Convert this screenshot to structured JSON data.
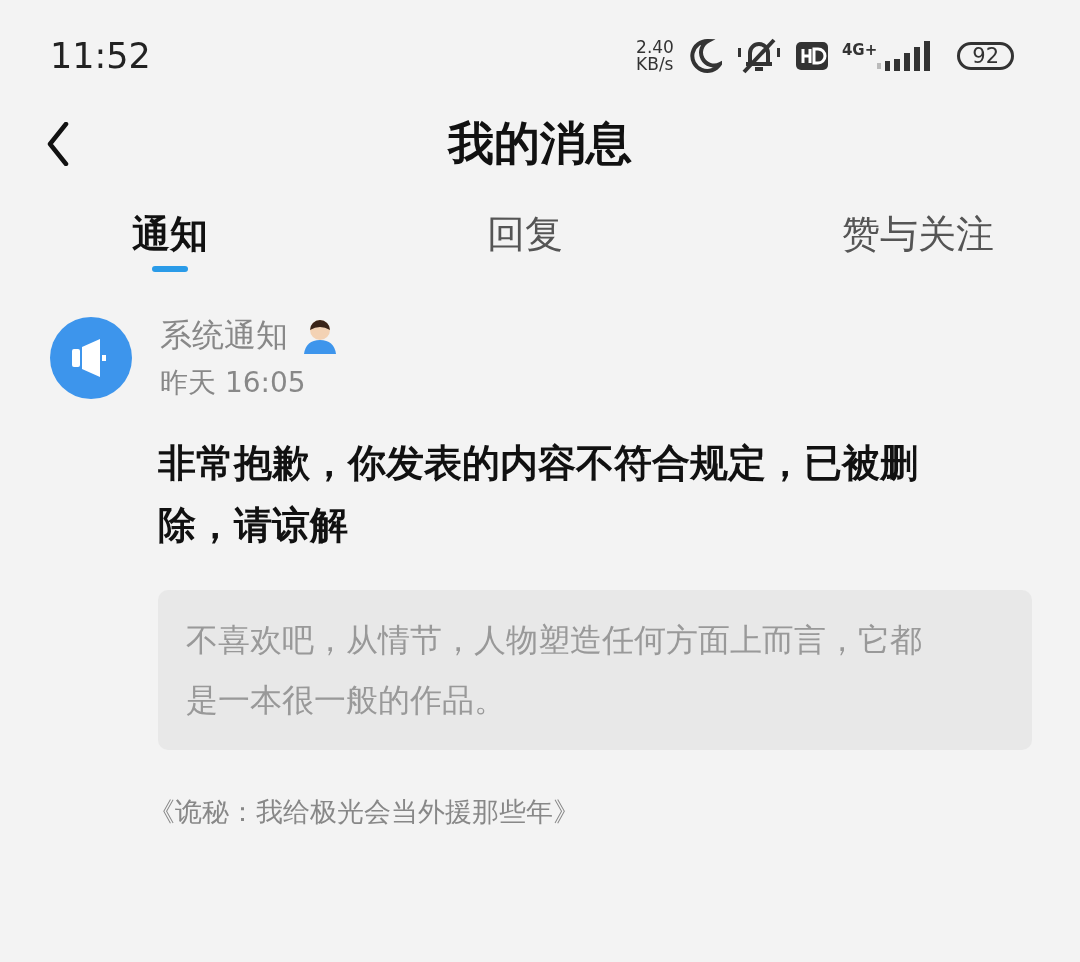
{
  "status_bar": {
    "time": "11:52",
    "speed_value": "2.40",
    "speed_unit": "KB/s",
    "network": "4G+",
    "battery": "92"
  },
  "header": {
    "title": "我的消息"
  },
  "tabs": [
    {
      "label": "通知",
      "selected": true
    },
    {
      "label": "回复",
      "selected": false
    },
    {
      "label": "赞与关注",
      "selected": false
    }
  ],
  "message": {
    "sender": "系统通知",
    "time": "昨天 16:05",
    "text": "非常抱歉，你发表的内容不符合规定，已被删除，请谅解",
    "quote": "不喜欢吧，从情节，人物塑造任何方面上而言，它都是一本很一般的作品。",
    "source": "《诡秘：我给极光会当外援那些年》"
  }
}
